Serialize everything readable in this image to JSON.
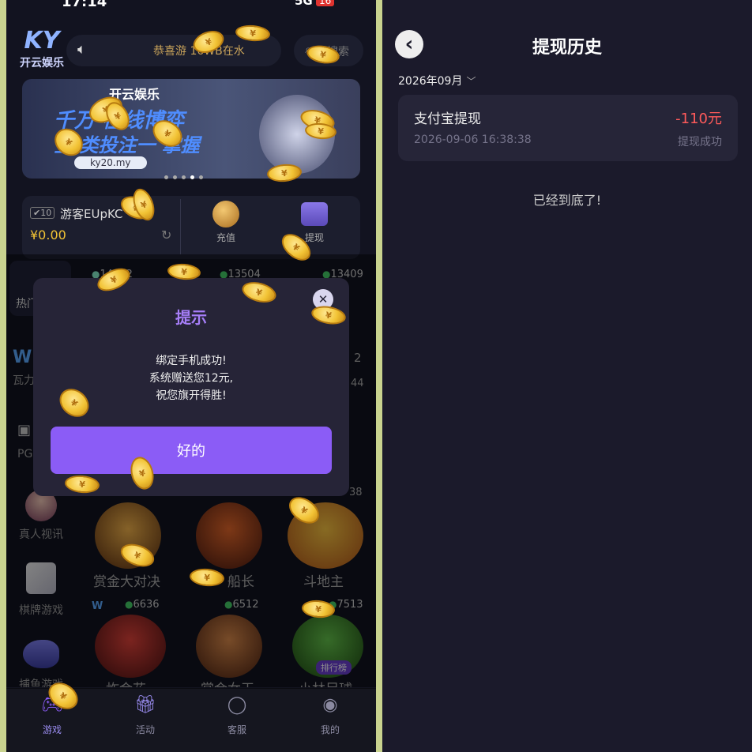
{
  "left": {
    "status_time": "17:14",
    "status_net": "5G",
    "status_battery": "16",
    "logo_letters": "KY",
    "logo_text": "开云娱乐",
    "marquee": "恭喜游 16WB在水",
    "search_placeholder": "搜索",
    "banner": {
      "brand": "开云娱乐",
      "headline1": "千万 在线博弈",
      "headline2": "全 类投注一 掌握",
      "url": "ky20.my"
    },
    "wallet": {
      "username": "游客EUpKC",
      "balance": "¥0.00",
      "recharge": "充值",
      "withdraw": "提现"
    },
    "side_categories": [
      "热门",
      "瓦力",
      "PG",
      "真人视讯",
      "棋牌游戏",
      "捕鱼游戏"
    ],
    "player_counts": [
      "14012",
      "13504",
      "13409"
    ],
    "side_counts": [
      "2",
      "44",
      "38"
    ],
    "games_row1": [
      "赏金大对决",
      "船长",
      "斗地主"
    ],
    "games_row2_counts": [
      "6636",
      "6512",
      "7513"
    ],
    "games_row2": [
      "炸金花",
      "赏金女王",
      "小林足球"
    ],
    "rank_badge": "排行榜",
    "modal": {
      "title": "提示",
      "line1": "绑定手机成功!",
      "line2": "系统赠送您12元,",
      "line3": "祝您旗开得胜!",
      "ok": "好的",
      "close": "✕"
    },
    "nav": [
      "游戏",
      "活动",
      "客服",
      "我的"
    ],
    "coin_symbol": "¥"
  },
  "right": {
    "back": "‹",
    "title": "提现历史",
    "month": "2026年09月",
    "record": {
      "name": "支付宝提现",
      "amount": "-110元",
      "time": "2026-09-06 16:38:38",
      "status": "提现成功"
    },
    "end_text": "已经到底了!"
  },
  "colors": {
    "accent": "#8b5cf6",
    "negative": "#ff5a5a",
    "coin": "#f2c335"
  }
}
